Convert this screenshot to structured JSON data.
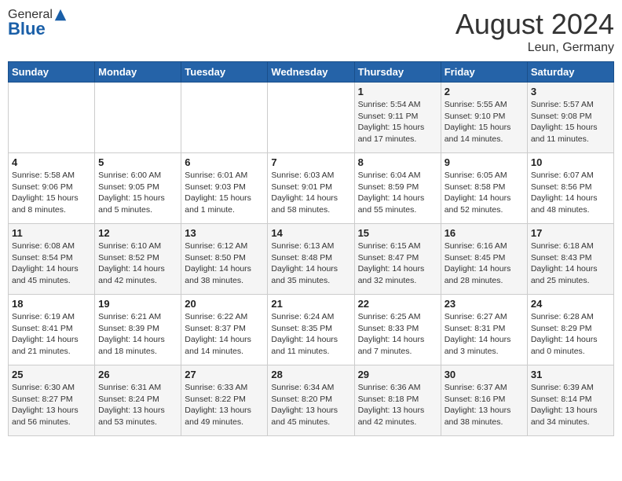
{
  "header": {
    "logo_general": "General",
    "logo_blue": "Blue",
    "month_year": "August 2024",
    "location": "Leun, Germany"
  },
  "days_of_week": [
    "Sunday",
    "Monday",
    "Tuesday",
    "Wednesday",
    "Thursday",
    "Friday",
    "Saturday"
  ],
  "weeks": [
    [
      {
        "num": "",
        "info": ""
      },
      {
        "num": "",
        "info": ""
      },
      {
        "num": "",
        "info": ""
      },
      {
        "num": "",
        "info": ""
      },
      {
        "num": "1",
        "info": "Sunrise: 5:54 AM\nSunset: 9:11 PM\nDaylight: 15 hours\nand 17 minutes."
      },
      {
        "num": "2",
        "info": "Sunrise: 5:55 AM\nSunset: 9:10 PM\nDaylight: 15 hours\nand 14 minutes."
      },
      {
        "num": "3",
        "info": "Sunrise: 5:57 AM\nSunset: 9:08 PM\nDaylight: 15 hours\nand 11 minutes."
      }
    ],
    [
      {
        "num": "4",
        "info": "Sunrise: 5:58 AM\nSunset: 9:06 PM\nDaylight: 15 hours\nand 8 minutes."
      },
      {
        "num": "5",
        "info": "Sunrise: 6:00 AM\nSunset: 9:05 PM\nDaylight: 15 hours\nand 5 minutes."
      },
      {
        "num": "6",
        "info": "Sunrise: 6:01 AM\nSunset: 9:03 PM\nDaylight: 15 hours\nand 1 minute."
      },
      {
        "num": "7",
        "info": "Sunrise: 6:03 AM\nSunset: 9:01 PM\nDaylight: 14 hours\nand 58 minutes."
      },
      {
        "num": "8",
        "info": "Sunrise: 6:04 AM\nSunset: 8:59 PM\nDaylight: 14 hours\nand 55 minutes."
      },
      {
        "num": "9",
        "info": "Sunrise: 6:05 AM\nSunset: 8:58 PM\nDaylight: 14 hours\nand 52 minutes."
      },
      {
        "num": "10",
        "info": "Sunrise: 6:07 AM\nSunset: 8:56 PM\nDaylight: 14 hours\nand 48 minutes."
      }
    ],
    [
      {
        "num": "11",
        "info": "Sunrise: 6:08 AM\nSunset: 8:54 PM\nDaylight: 14 hours\nand 45 minutes."
      },
      {
        "num": "12",
        "info": "Sunrise: 6:10 AM\nSunset: 8:52 PM\nDaylight: 14 hours\nand 42 minutes."
      },
      {
        "num": "13",
        "info": "Sunrise: 6:12 AM\nSunset: 8:50 PM\nDaylight: 14 hours\nand 38 minutes."
      },
      {
        "num": "14",
        "info": "Sunrise: 6:13 AM\nSunset: 8:48 PM\nDaylight: 14 hours\nand 35 minutes."
      },
      {
        "num": "15",
        "info": "Sunrise: 6:15 AM\nSunset: 8:47 PM\nDaylight: 14 hours\nand 32 minutes."
      },
      {
        "num": "16",
        "info": "Sunrise: 6:16 AM\nSunset: 8:45 PM\nDaylight: 14 hours\nand 28 minutes."
      },
      {
        "num": "17",
        "info": "Sunrise: 6:18 AM\nSunset: 8:43 PM\nDaylight: 14 hours\nand 25 minutes."
      }
    ],
    [
      {
        "num": "18",
        "info": "Sunrise: 6:19 AM\nSunset: 8:41 PM\nDaylight: 14 hours\nand 21 minutes."
      },
      {
        "num": "19",
        "info": "Sunrise: 6:21 AM\nSunset: 8:39 PM\nDaylight: 14 hours\nand 18 minutes."
      },
      {
        "num": "20",
        "info": "Sunrise: 6:22 AM\nSunset: 8:37 PM\nDaylight: 14 hours\nand 14 minutes."
      },
      {
        "num": "21",
        "info": "Sunrise: 6:24 AM\nSunset: 8:35 PM\nDaylight: 14 hours\nand 11 minutes."
      },
      {
        "num": "22",
        "info": "Sunrise: 6:25 AM\nSunset: 8:33 PM\nDaylight: 14 hours\nand 7 minutes."
      },
      {
        "num": "23",
        "info": "Sunrise: 6:27 AM\nSunset: 8:31 PM\nDaylight: 14 hours\nand 3 minutes."
      },
      {
        "num": "24",
        "info": "Sunrise: 6:28 AM\nSunset: 8:29 PM\nDaylight: 14 hours\nand 0 minutes."
      }
    ],
    [
      {
        "num": "25",
        "info": "Sunrise: 6:30 AM\nSunset: 8:27 PM\nDaylight: 13 hours\nand 56 minutes."
      },
      {
        "num": "26",
        "info": "Sunrise: 6:31 AM\nSunset: 8:24 PM\nDaylight: 13 hours\nand 53 minutes."
      },
      {
        "num": "27",
        "info": "Sunrise: 6:33 AM\nSunset: 8:22 PM\nDaylight: 13 hours\nand 49 minutes."
      },
      {
        "num": "28",
        "info": "Sunrise: 6:34 AM\nSunset: 8:20 PM\nDaylight: 13 hours\nand 45 minutes."
      },
      {
        "num": "29",
        "info": "Sunrise: 6:36 AM\nSunset: 8:18 PM\nDaylight: 13 hours\nand 42 minutes."
      },
      {
        "num": "30",
        "info": "Sunrise: 6:37 AM\nSunset: 8:16 PM\nDaylight: 13 hours\nand 38 minutes."
      },
      {
        "num": "31",
        "info": "Sunrise: 6:39 AM\nSunset: 8:14 PM\nDaylight: 13 hours\nand 34 minutes."
      }
    ]
  ]
}
